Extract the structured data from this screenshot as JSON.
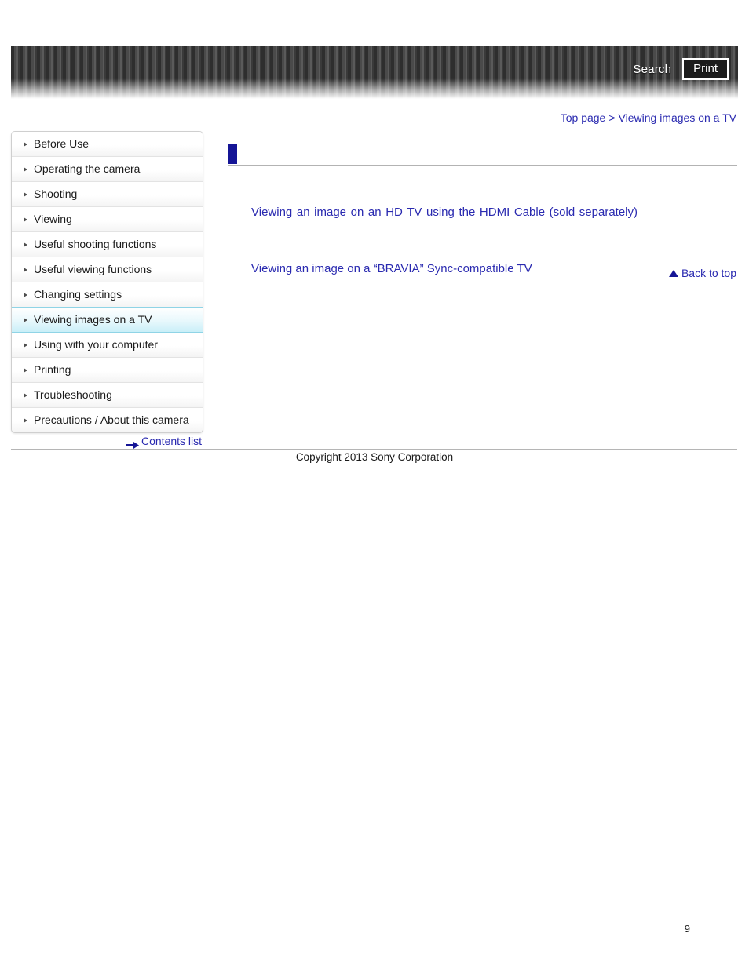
{
  "header": {
    "search_label": "Search",
    "print_label": "Print",
    "search_icon": "search-icon",
    "print_icon": "print-icon"
  },
  "breadcrumb": {
    "top_page": "Top page",
    "separator": ">",
    "current": "Viewing images on a TV"
  },
  "sidebar": {
    "items": [
      {
        "label": "Before Use",
        "selected": false
      },
      {
        "label": "Operating the camera",
        "selected": false
      },
      {
        "label": "Shooting",
        "selected": false
      },
      {
        "label": "Viewing",
        "selected": false
      },
      {
        "label": "Useful shooting functions",
        "selected": false
      },
      {
        "label": "Useful viewing functions",
        "selected": false
      },
      {
        "label": "Changing settings",
        "selected": false
      },
      {
        "label": "Viewing images on a TV",
        "selected": true
      },
      {
        "label": "Using with your computer",
        "selected": false
      },
      {
        "label": "Printing",
        "selected": false
      },
      {
        "label": "Troubleshooting",
        "selected": false
      },
      {
        "label": "Precautions / About this camera",
        "selected": false
      }
    ],
    "contents_list_label": "Contents list"
  },
  "main": {
    "heading": "",
    "links": [
      "Viewing an image on an HD TV using the HDMI Cable (sold separately)",
      "Viewing an image on a “BRAVIA” Sync-compatible TV"
    ],
    "back_to_top_label": "Back to top"
  },
  "footer": {
    "copyright": "Copyright 2013 Sony Corporation",
    "page_number": "9"
  },
  "colors": {
    "link_blue": "#2a2ab0",
    "heading_navy": "#151596",
    "selected_cyan": "#c9eff8",
    "header_dark": "#2e2e2e"
  }
}
